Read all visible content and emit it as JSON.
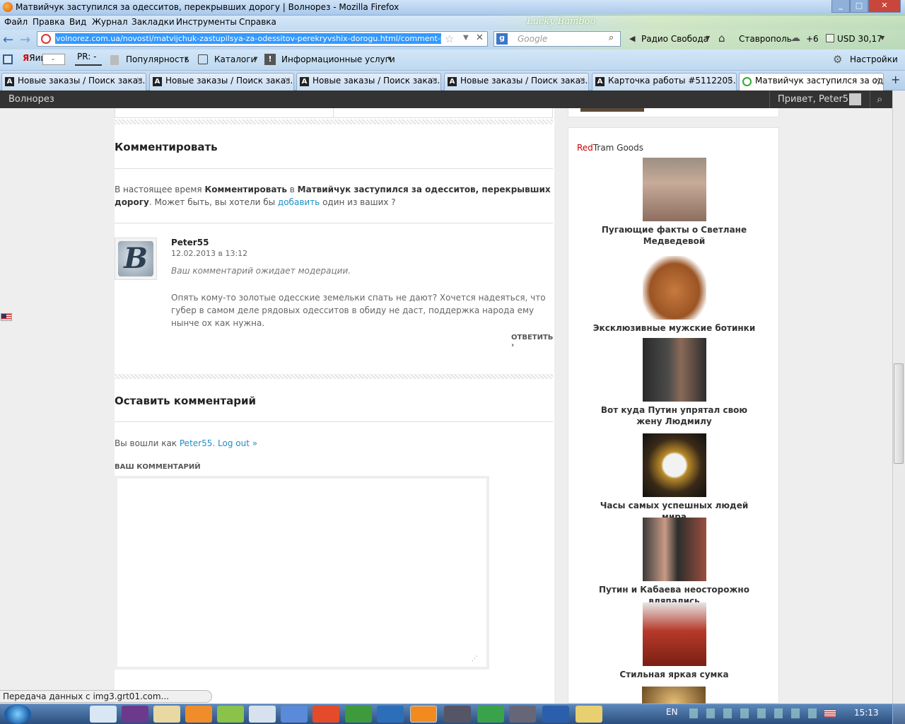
{
  "window": {
    "title": "Матвийчук заступился за одесситов, перекрывших дорогу | Волнорез - Mozilla Firefox"
  },
  "menu": [
    "Файл",
    "Правка",
    "Вид",
    "Журнал",
    "Закладки",
    "Инструменты",
    "Справка"
  ],
  "nav": {
    "url": "volnorez.com.ua/novosti/matvijchuk-zastupilsya-za-odessitov-perekryvshix-dorogu.html/comment-pa",
    "search_placeholder": "Google",
    "radio": "Радио Свобода",
    "city": "Ставрополь",
    "temp": "+6",
    "currency": "USD 30,17",
    "theme": "Lucky Bamboo"
  },
  "toolbar": {
    "yandex": "Яиц:",
    "yandex_val": "-",
    "pr": "PR: -",
    "popularity": "Популярность",
    "catalogs": "Каталоги",
    "info": "Информационные услуги",
    "settings": "Настройки"
  },
  "tabs": [
    "Новые заказы / Поиск заказ...",
    "Новые заказы / Поиск заказ...",
    "Новые заказы / Поиск заказ...",
    "Новые заказы / Поиск заказ...",
    "Карточка работы #5112205.4...",
    "Матвийчук заступился за од..."
  ],
  "wpbar": {
    "site": "Волнорез",
    "greeting": "Привет, Peter55"
  },
  "comment_section": {
    "heading": "Комментировать",
    "notice_pre": "В настоящее время ",
    "notice_b1": "Комментировать",
    "notice_mid": " в ",
    "notice_b2": "Матвийчук заступился за одесситов, перекрывших дорогу",
    "notice_post": ". Может быть, вы хотели бы ",
    "notice_link": "добавить",
    "notice_end": " один из ваших ?",
    "comment": {
      "author": "Peter55",
      "date": "12.02.2013 в 13:12",
      "moderation": "Ваш комментарий ожидает модерации.",
      "text": "Опять кому-то золотые одесские земельки спать не дают? Хочется надеяться, что губер в самом деле рядовых одесситов в обиду не даст, поддержка народа ему нынче ох как нужна.",
      "reply": "ОТВЕТИТЬ"
    }
  },
  "leave_comment": {
    "heading": "Оставить комментарий",
    "logged_pre": "Вы вошли как ",
    "logged_user": "Peter55",
    "logout": "Log out »",
    "label": "ВАШ КОММЕНТАРИЙ"
  },
  "sidebar": {
    "widget_red": "Red",
    "widget_rest": "Tram Goods",
    "items": [
      {
        "caption": "Пугающие факты о Светлане Медведевой"
      },
      {
        "caption": "Эксклюзивные мужские ботинки"
      },
      {
        "caption": "Вот куда Путин упрятал свою жену Людмилу"
      },
      {
        "caption": "Часы самых успешных людей мира"
      },
      {
        "caption": "Путин и Кабаева неосторожно вляпались"
      },
      {
        "caption": "Стильная яркая сумка"
      }
    ]
  },
  "status": "Передача данных с img3.grt01.com...",
  "taskbar": {
    "lang": "EN",
    "clock": "15:13"
  },
  "colors": {
    "link": "#1f8ec7",
    "adminbar": "#333333",
    "red": "#cc0000"
  }
}
